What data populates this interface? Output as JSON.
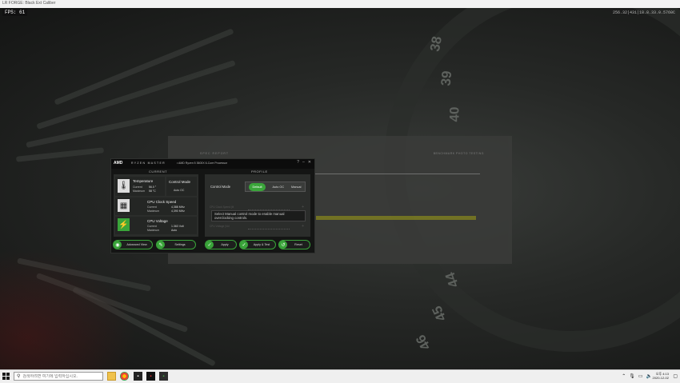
{
  "browser": {
    "address": "LR FORGE: Black Ext Caliber"
  },
  "overlay": {
    "fps": "FPS: 61",
    "version": "256.32|431|18.8.33.0.5760C"
  },
  "background_window": {
    "title": "SPEC REPORT",
    "right_title": "BENCHMARK PHOTO TESTING"
  },
  "dial_numbers": [
    "38",
    "39",
    "40",
    "44",
    "45",
    "46"
  ],
  "ryzen_master": {
    "logo": "AMD",
    "app_name": "RYZEN MASTER",
    "processor": "• AMD Ryzen 5 3600X 6-Core Processor",
    "window_controls": [
      "?",
      "–",
      "✕"
    ],
    "current_header": "CURRENT",
    "profile_header": "PROFILE",
    "temperature": {
      "name": "Temperature",
      "current_label": "Current",
      "current_value": "56.0 °",
      "max_label": "Maximum",
      "max_value": "58 °C"
    },
    "control_mode_tile": {
      "name": "Control Mode",
      "value": "Auto OC"
    },
    "clock": {
      "name": "CPU Clock Speed",
      "current_label": "Current",
      "current_value": "4,388 MHz",
      "max_label": "Maximum",
      "max_value": "4,390 MHz"
    },
    "voltage": {
      "name": "CPU Voltage",
      "current_label": "Current",
      "current_value": "1.363 Volt",
      "max_label": "Maximum",
      "max_value": "Auto"
    },
    "profile_control_label": "Control Mode",
    "modes": [
      "Default",
      "Auto OC",
      "Manual"
    ],
    "selected_mode": "Default",
    "slider1_label": "CPU Clock Speed (M",
    "slider2_label": "CPU Voltage (Vol",
    "tooltip": "Select Manual control mode to enable manual overclocking controls.",
    "buttons": {
      "advanced": "Advanced View",
      "settings": "Settings",
      "apply": "Apply",
      "apply_test": "Apply & Test",
      "reset": "Reset"
    },
    "accent": "#3aa53a"
  },
  "taskbar": {
    "search_placeholder": "검색하려면 여기에 입력하십시오.",
    "clock_time": "오후 4:13",
    "clock_date": "2020-12-02"
  }
}
